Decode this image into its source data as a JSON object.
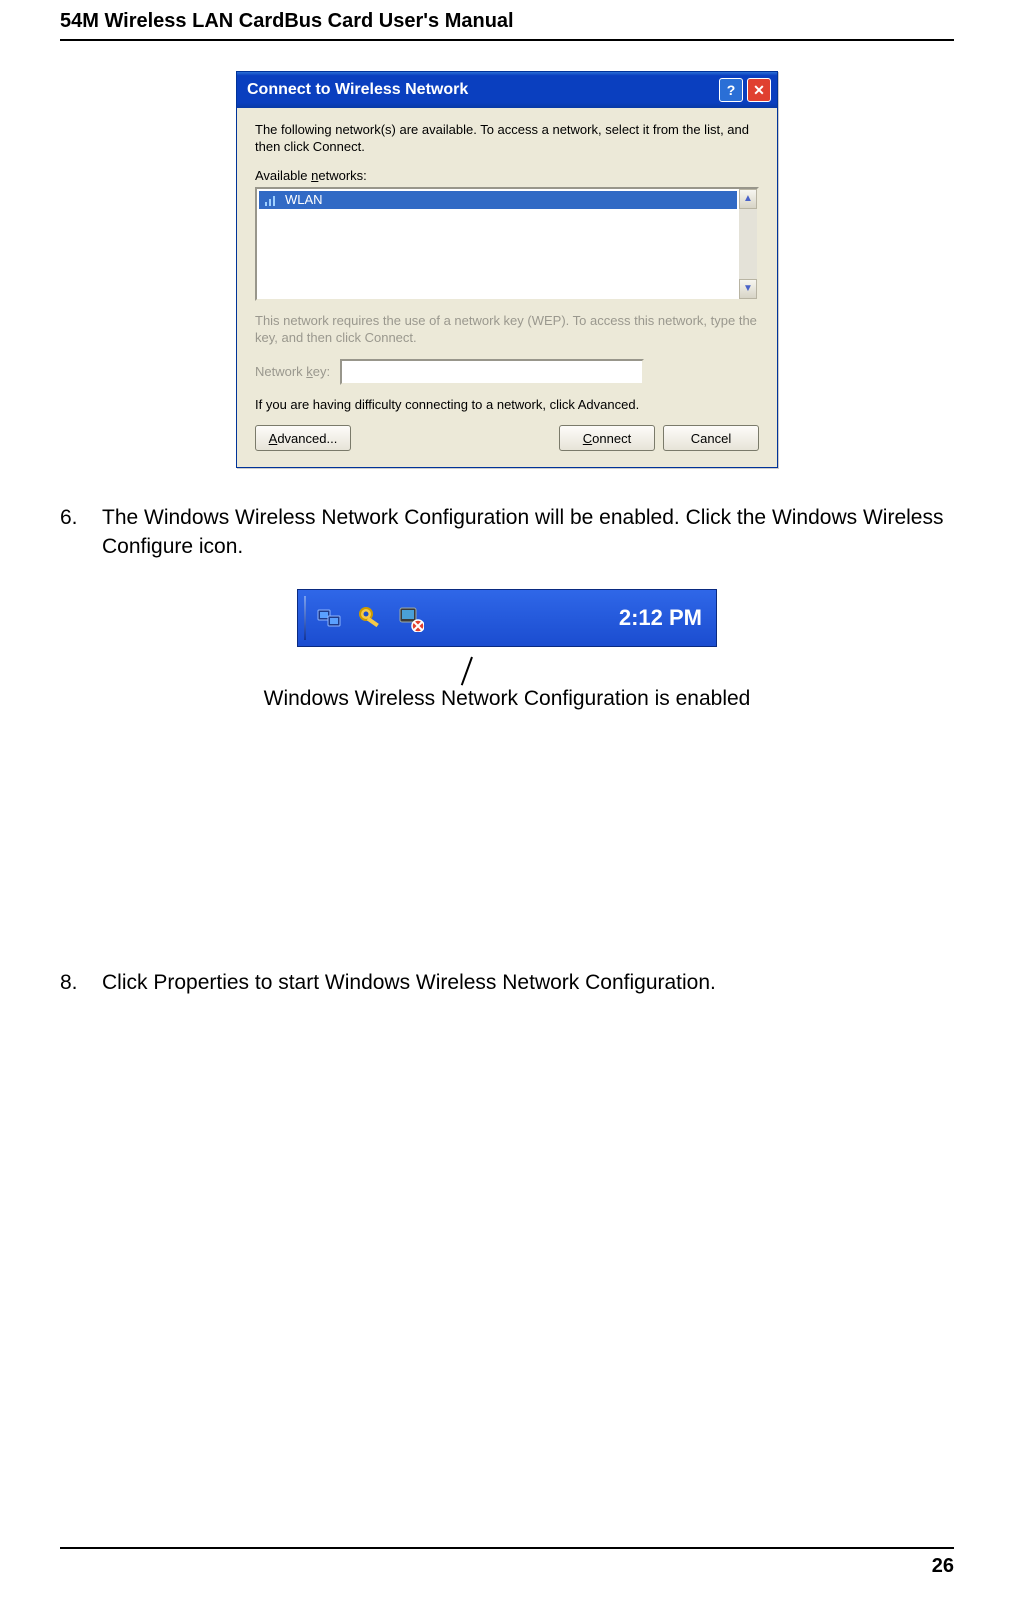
{
  "header": {
    "title": "54M Wireless LAN CardBus Card User's Manual"
  },
  "dialog": {
    "title": "Connect to Wireless Network",
    "instruction": "The following network(s) are available. To access a network, select it from the list, and then click Connect.",
    "available_label_pre": "Available ",
    "available_label_u": "n",
    "available_label_post": "etworks:",
    "list_item": "WLAN",
    "wep_note": "This network requires the use of a network key (WEP). To access this network, type the key, and then click Connect.",
    "key_label_pre": "Network ",
    "key_label_u": "k",
    "key_label_post": "ey:",
    "difficulty_note": "If you are having difficulty connecting to a network, click Advanced.",
    "advanced_u": "A",
    "advanced_post": "dvanced...",
    "connect_u": "C",
    "connect_post": "onnect",
    "cancel_label": "Cancel"
  },
  "step6": {
    "num": "6.",
    "text": "The Windows Wireless Network Configuration will be enabled. Click the Windows Wireless Configure icon."
  },
  "tray": {
    "time": "2:12 PM"
  },
  "caption": "Windows Wireless Network Configuration is enabled",
  "step8": {
    "num": "8.",
    "text": "Click Properties to start Windows Wireless Network Configuration."
  },
  "page_number": "26"
}
